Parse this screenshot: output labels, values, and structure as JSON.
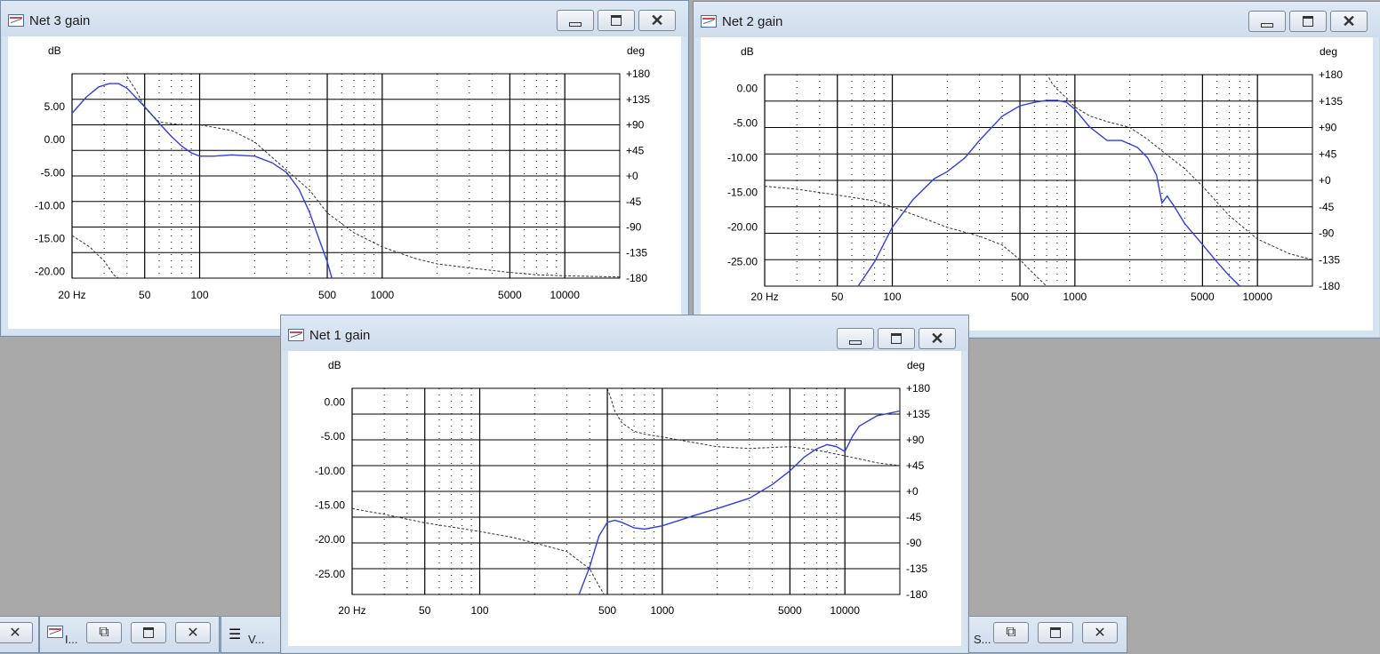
{
  "colors": {
    "magnitude_line": "#2f3fe0",
    "phase_line": "#333333",
    "grid": "#000000",
    "desktop": "#a9a9a9"
  },
  "windows": [
    {
      "id": "net3",
      "title": "Net 3 gain",
      "buttons": {
        "minimize": "minimize-icon",
        "maximize": "maximize-icon",
        "close": "close-icon"
      }
    },
    {
      "id": "net2",
      "title": "Net 2 gain",
      "buttons": {
        "minimize": "minimize-icon",
        "maximize": "maximize-icon",
        "close": "close-icon"
      }
    },
    {
      "id": "net1",
      "title": "Net 1 gain",
      "buttons": {
        "minimize": "minimize-icon",
        "maximize": "maximize-icon",
        "close": "close-icon"
      }
    }
  ],
  "taskbar": {
    "items": [
      {
        "label": "I..."
      },
      {
        "label": "V..."
      },
      {
        "label": "S..."
      }
    ]
  },
  "chart_data": [
    {
      "id": "net3",
      "type": "line",
      "ylabel_left": "dB",
      "ylabel_right": "deg",
      "xscale": "log",
      "xlim": [
        20,
        20000
      ],
      "xticks": [
        20,
        50,
        100,
        500,
        1000,
        5000,
        10000
      ],
      "xtick_labels": [
        "20 Hz",
        "50",
        "100",
        "500",
        "1000",
        "5000",
        "10000"
      ],
      "ylim_left": [
        -21,
        10
      ],
      "yticks_left": [
        5,
        0,
        -5,
        -10,
        -15,
        -20
      ],
      "ytick_labels_left": [
        "5.00",
        "0.00",
        "-5.00",
        "-10.00",
        "-15.00",
        "-20.00"
      ],
      "ylim_right": [
        -180,
        180
      ],
      "yticks_right": [
        180,
        135,
        90,
        45,
        0,
        -45,
        -90,
        -135,
        -180
      ],
      "ytick_labels_right": [
        "+180",
        "+135",
        "+90",
        "+45",
        "+0",
        "-45",
        "-90",
        "-135",
        "-180"
      ],
      "grid": true,
      "series": [
        {
          "axis": "left",
          "style": "solid",
          "x": [
            20,
            24,
            28,
            32,
            36,
            40,
            50,
            60,
            70,
            80,
            90,
            100,
            120,
            150,
            200,
            250,
            300,
            350,
            400,
            450,
            500,
            530
          ],
          "y": [
            4,
            6.5,
            8,
            8.5,
            8.5,
            7.8,
            5,
            2.5,
            0.5,
            -1,
            -2,
            -2.5,
            -2.5,
            -2.3,
            -2.5,
            -3.5,
            -5,
            -7.5,
            -11,
            -15,
            -18.5,
            -21
          ]
        },
        {
          "axis": "right",
          "style": "dashed",
          "x": [
            20,
            25,
            30,
            34,
            36,
            40,
            45,
            50,
            60,
            80,
            100,
            150,
            200,
            300,
            400,
            500,
            700,
            1000,
            1500,
            2000,
            3000,
            5000,
            7000,
            10000,
            20000
          ],
          "y": [
            -105,
            -125,
            -150,
            -175,
            -180,
            175,
            150,
            120,
            95,
            90,
            90,
            80,
            60,
            10,
            -25,
            -65,
            -100,
            -125,
            -145,
            -155,
            -162,
            -170,
            -174,
            -176,
            -178
          ]
        }
      ]
    },
    {
      "id": "net2",
      "type": "line",
      "ylabel_left": "dB",
      "ylabel_right": "deg",
      "xscale": "log",
      "xlim": [
        20,
        20000
      ],
      "xticks": [
        20,
        50,
        100,
        500,
        1000,
        5000,
        10000
      ],
      "xtick_labels": [
        "20 Hz",
        "50",
        "100",
        "500",
        "1000",
        "5000",
        "10000"
      ],
      "ylim_left": [
        -28.5,
        2
      ],
      "yticks_left": [
        0,
        -5,
        -10,
        -15,
        -20,
        -25
      ],
      "ytick_labels_left": [
        "0.00",
        "-5.00",
        "-10.00",
        "-15.00",
        "-20.00",
        "-25.00"
      ],
      "ylim_right": [
        -180,
        180
      ],
      "yticks_right": [
        180,
        135,
        90,
        45,
        0,
        -45,
        -90,
        -135,
        -180
      ],
      "ytick_labels_right": [
        "+180",
        "+135",
        "+90",
        "+45",
        "+0",
        "-45",
        "-90",
        "-135",
        "-180"
      ],
      "grid": true,
      "series": [
        {
          "axis": "left",
          "style": "solid",
          "x": [
            65,
            80,
            100,
            130,
            170,
            200,
            250,
            300,
            400,
            500,
            600,
            700,
            800,
            900,
            1000,
            1200,
            1500,
            1800,
            2200,
            2500,
            2800,
            3000,
            3200,
            3500,
            4000,
            5000,
            6000,
            7000,
            8000
          ],
          "y": [
            -28.5,
            -25,
            -20,
            -16,
            -13,
            -12,
            -10,
            -7.5,
            -4,
            -2.5,
            -2,
            -1.7,
            -1.7,
            -2,
            -3,
            -5.5,
            -7.5,
            -7.5,
            -8.5,
            -10,
            -12.5,
            -16.5,
            -15.5,
            -17,
            -19.5,
            -22.5,
            -25,
            -27,
            -28.5
          ]
        },
        {
          "axis": "right",
          "style": "dashed",
          "x": [
            20,
            30,
            50,
            80,
            100,
            150,
            200,
            300,
            400,
            500,
            600,
            700,
            720,
            750,
            800,
            900,
            1000,
            1200,
            1500,
            2000,
            2500,
            3000,
            4000,
            5000,
            7000,
            10000,
            15000,
            20000
          ],
          "y": [
            -10,
            -15,
            -25,
            -35,
            -45,
            -65,
            -80,
            -95,
            -110,
            -135,
            -160,
            -180,
            175,
            165,
            155,
            140,
            125,
            110,
            100,
            90,
            70,
            50,
            20,
            -10,
            -60,
            -100,
            -125,
            -135
          ]
        }
      ]
    },
    {
      "id": "net1",
      "type": "line",
      "ylabel_left": "dB",
      "ylabel_right": "deg",
      "xscale": "log",
      "xlim": [
        20,
        20000
      ],
      "xticks": [
        20,
        50,
        100,
        500,
        1000,
        5000,
        10000
      ],
      "xtick_labels": [
        "20 Hz",
        "50",
        "100",
        "500",
        "1000",
        "5000",
        "10000"
      ],
      "ylim_left": [
        -28,
        2
      ],
      "yticks_left": [
        0,
        -5,
        -10,
        -15,
        -20,
        -25
      ],
      "ytick_labels_left": [
        "0.00",
        "-5.00",
        "-10.00",
        "-15.00",
        "-20.00",
        "-25.00"
      ],
      "ylim_right": [
        -180,
        180
      ],
      "yticks_right": [
        180,
        135,
        90,
        45,
        0,
        -45,
        -90,
        -135,
        -180
      ],
      "ytick_labels_right": [
        "+180",
        "+135",
        "+90",
        "+45",
        "+0",
        "-45",
        "-90",
        "-135",
        "-180"
      ],
      "grid": true,
      "series": [
        {
          "axis": "left",
          "style": "solid",
          "x": [
            350,
            400,
            450,
            500,
            550,
            600,
            700,
            800,
            1000,
            1500,
            2000,
            3000,
            4000,
            5000,
            6000,
            7000,
            8000,
            9000,
            10000,
            11000,
            12000,
            15000,
            20000
          ],
          "y": [
            -28,
            -24,
            -19.5,
            -17.5,
            -17.2,
            -17.5,
            -18.3,
            -18.5,
            -18,
            -16.5,
            -15.5,
            -14,
            -12,
            -10,
            -8,
            -6.8,
            -6.2,
            -6.5,
            -7.2,
            -5,
            -3.5,
            -2,
            -1.3
          ]
        },
        {
          "axis": "right",
          "style": "dashed",
          "x": [
            20,
            30,
            50,
            80,
            100,
            150,
            200,
            300,
            400,
            450,
            480,
            500,
            520,
            550,
            600,
            700,
            800,
            1000,
            1500,
            2000,
            3000,
            5000,
            7000,
            10000,
            15000,
            20000
          ],
          "y": [
            -30,
            -40,
            -55,
            -65,
            -70,
            -80,
            -90,
            -105,
            -135,
            -165,
            -180,
            180,
            165,
            140,
            120,
            105,
            100,
            95,
            85,
            78,
            75,
            78,
            72,
            62,
            50,
            45
          ]
        }
      ]
    }
  ]
}
